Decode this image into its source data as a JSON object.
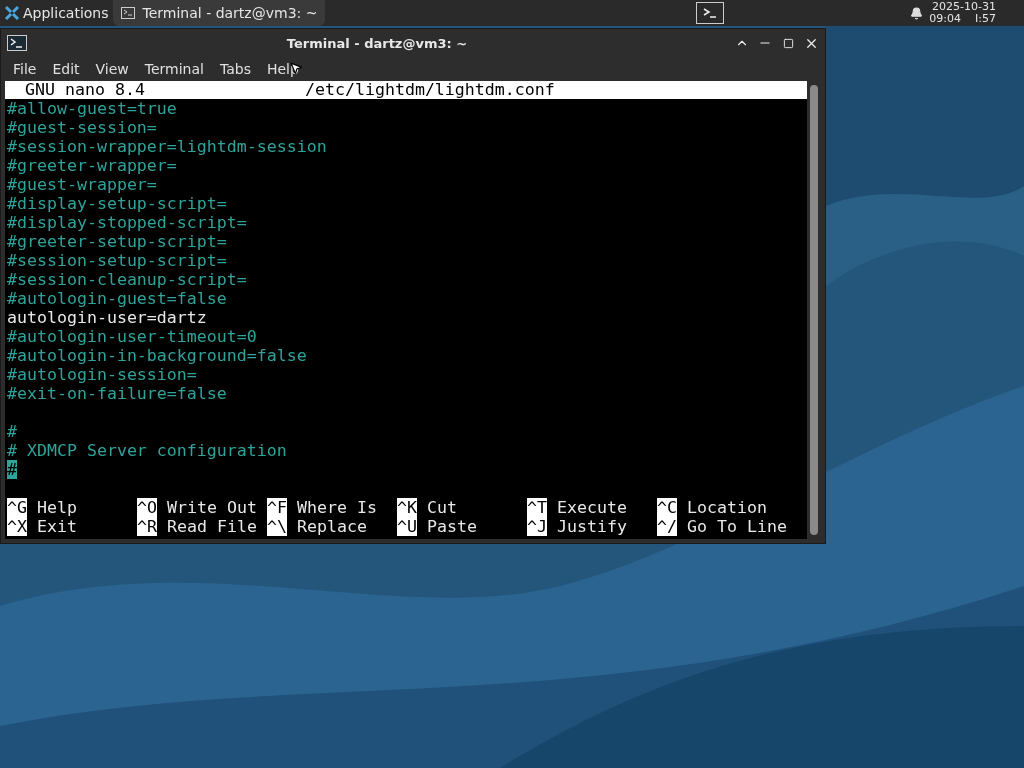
{
  "taskbar": {
    "apps_menu": "Applications",
    "tasks": [
      {
        "label": "Terminal - dartz@vm3: ~",
        "selected": true
      }
    ],
    "clock": {
      "date": "2025-10-31",
      "time": "09:04",
      "extra": "I:57"
    }
  },
  "window": {
    "title": "Terminal - dartz@vm3: ~",
    "menu": [
      "File",
      "Edit",
      "View",
      "Terminal",
      "Tabs",
      "Help"
    ],
    "nano": {
      "version": "GNU nano 8.4",
      "file": "/etc/lightdm/lightdm.conf",
      "lines": [
        {
          "kind": "comment",
          "text": "#allow-guest=true",
          "cursor": false
        },
        {
          "kind": "comment",
          "text": "#guest-session=",
          "cursor": false
        },
        {
          "kind": "comment",
          "text": "#session-wrapper=lightdm-session",
          "cursor": false
        },
        {
          "kind": "comment",
          "text": "#greeter-wrapper=",
          "cursor": false
        },
        {
          "kind": "comment",
          "text": "#guest-wrapper=",
          "cursor": false
        },
        {
          "kind": "comment",
          "text": "#display-setup-script=",
          "cursor": false
        },
        {
          "kind": "comment",
          "text": "#display-stopped-script=",
          "cursor": false
        },
        {
          "kind": "comment",
          "text": "#greeter-setup-script=",
          "cursor": false
        },
        {
          "kind": "comment",
          "text": "#session-setup-script=",
          "cursor": false
        },
        {
          "kind": "comment",
          "text": "#session-cleanup-script=",
          "cursor": false
        },
        {
          "kind": "comment",
          "text": "#autologin-guest=false",
          "cursor": false
        },
        {
          "kind": "setting",
          "text": "autologin-user=dartz",
          "cursor": false
        },
        {
          "kind": "comment",
          "text": "#autologin-user-timeout=0",
          "cursor": false
        },
        {
          "kind": "comment",
          "text": "#autologin-in-background=false",
          "cursor": false
        },
        {
          "kind": "comment",
          "text": "#autologin-session=",
          "cursor": false
        },
        {
          "kind": "comment",
          "text": "#exit-on-failure=false",
          "cursor": false
        },
        {
          "kind": "blank"
        },
        {
          "kind": "comment",
          "text": "#",
          "cursor": false
        },
        {
          "kind": "comment",
          "text": "# XDMCP Server configuration",
          "cursor": false
        },
        {
          "kind": "comment",
          "text": "#",
          "cursor": true
        }
      ],
      "shortcuts": [
        {
          "key": "^G",
          "label": "Help"
        },
        {
          "key": "^O",
          "label": "Write Out"
        },
        {
          "key": "^F",
          "label": "Where Is"
        },
        {
          "key": "^K",
          "label": "Cut"
        },
        {
          "key": "^T",
          "label": "Execute"
        },
        {
          "key": "^C",
          "label": "Location"
        },
        {
          "key": "^X",
          "label": "Exit"
        },
        {
          "key": "^R",
          "label": "Read File"
        },
        {
          "key": "^\\",
          "label": "Replace"
        },
        {
          "key": "^U",
          "label": "Paste"
        },
        {
          "key": "^J",
          "label": "Justify"
        },
        {
          "key": "^/",
          "label": "Go To Line"
        }
      ]
    }
  }
}
